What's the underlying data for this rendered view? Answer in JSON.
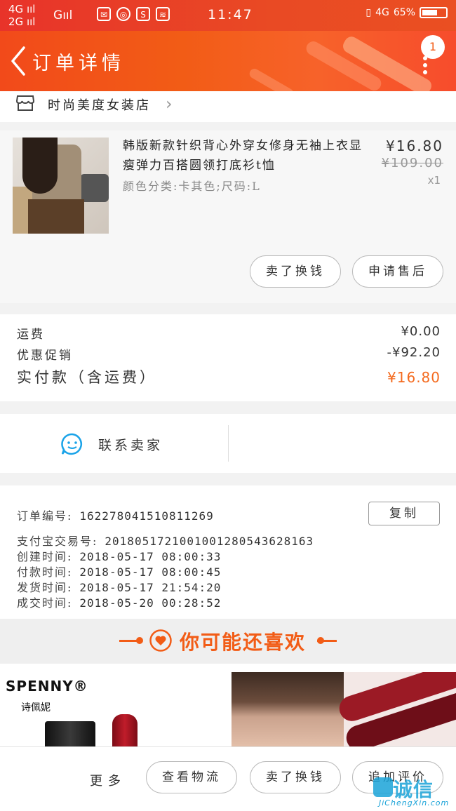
{
  "status_bar": {
    "network_1": "4G",
    "network_2": "2G",
    "network_3": "G",
    "time": "11:47",
    "network_right": "4G",
    "battery": "65%",
    "battery_level": 0.65
  },
  "navbar": {
    "title": "订单详情",
    "message_count": "1"
  },
  "shop": {
    "name": "时尚美度女装店"
  },
  "product": {
    "title": "韩版新款针织背心外穿女修身无袖上衣显瘦弹力百搭圆领打底衫t恤",
    "sku": "颜色分类:卡其色;尺码:L",
    "price": "¥16.80",
    "original_price": "¥109.00",
    "quantity": "x1",
    "buttons": {
      "exchange": "卖了换钱",
      "after_sale": "申请售后"
    }
  },
  "fees": {
    "shipping_label": "运费",
    "shipping_value": "¥0.00",
    "discount_label": "优惠促销",
    "discount_value": "-¥92.20",
    "total_label": "实付款（含运费）",
    "total_value": "¥16.80"
  },
  "contact": {
    "label": "联系卖家"
  },
  "order_info": {
    "order_no_label": "订单编号:",
    "order_no": "162278041510811269",
    "copy_label": "复制",
    "alipay_label": "支付宝交易号:",
    "alipay_no": "2018051721001001280543628163",
    "created_label": "创建时间:",
    "created": "2018-05-17 08:00:33",
    "paid_label": "付款时间:",
    "paid": "2018-05-17 08:00:45",
    "shipped_label": "发货时间:",
    "shipped": "2018-05-17 21:54:20",
    "completed_label": "成交时间:",
    "completed": "2018-05-20 00:28:52"
  },
  "recommend": {
    "title": "你可能还喜欢",
    "item1_brand": "SPENNY®",
    "item1_brand_cn": "诗佩妮"
  },
  "bottom_bar": {
    "more": "更多",
    "logistics": "查看物流",
    "exchange": "卖了换钱",
    "review": "追加评价"
  },
  "watermark": {
    "text": "JiChengXin.com",
    "cn": "诚信"
  },
  "colors": {
    "brand": "#f25c16",
    "price_accent": "#f46a1e",
    "watermark": "#1aa3d8"
  }
}
